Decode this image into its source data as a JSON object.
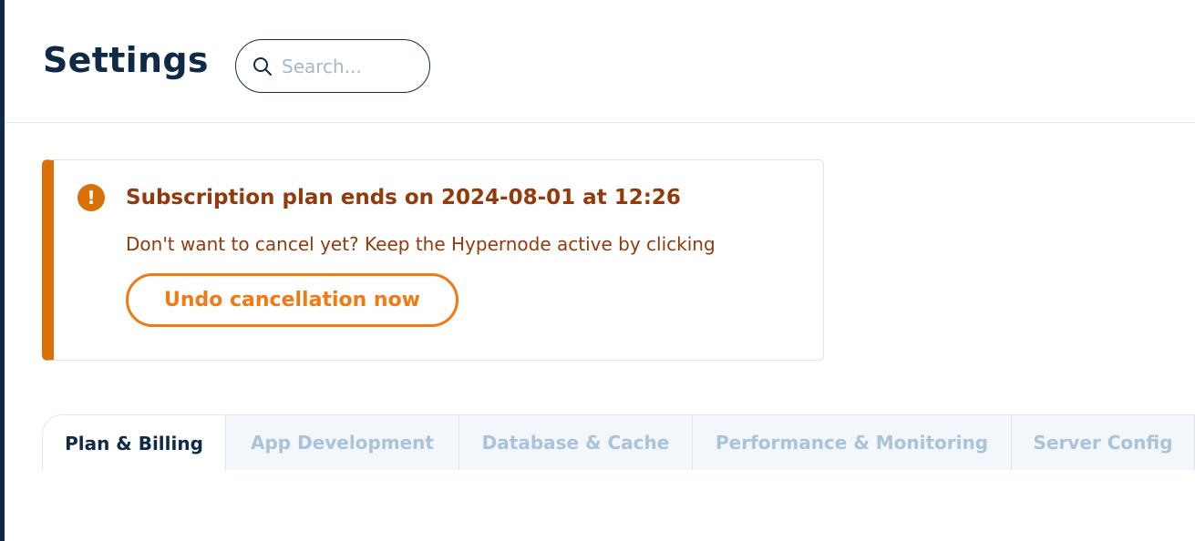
{
  "header": {
    "title": "Settings",
    "search_placeholder": "Search..."
  },
  "alert": {
    "icon": "exclamation-icon",
    "title": "Subscription plan ends on 2024-08-01 at 12:26",
    "message": "Don't want to cancel yet? Keep the Hypernode active by clicking",
    "button_label": "Undo cancellation now",
    "accent_color": "#d97008",
    "text_color": "#923a0c",
    "button_color": "#f07a13"
  },
  "tabs": [
    {
      "label": "Plan & Billing",
      "active": true
    },
    {
      "label": "App Development",
      "active": false
    },
    {
      "label": "Database & Cache",
      "active": false
    },
    {
      "label": "Performance & Monitoring",
      "active": false
    },
    {
      "label": "Server Config",
      "active": false
    }
  ],
  "colors": {
    "brand_dark": "#0f2a47",
    "inactive_tab_text": "#a9c4da"
  }
}
